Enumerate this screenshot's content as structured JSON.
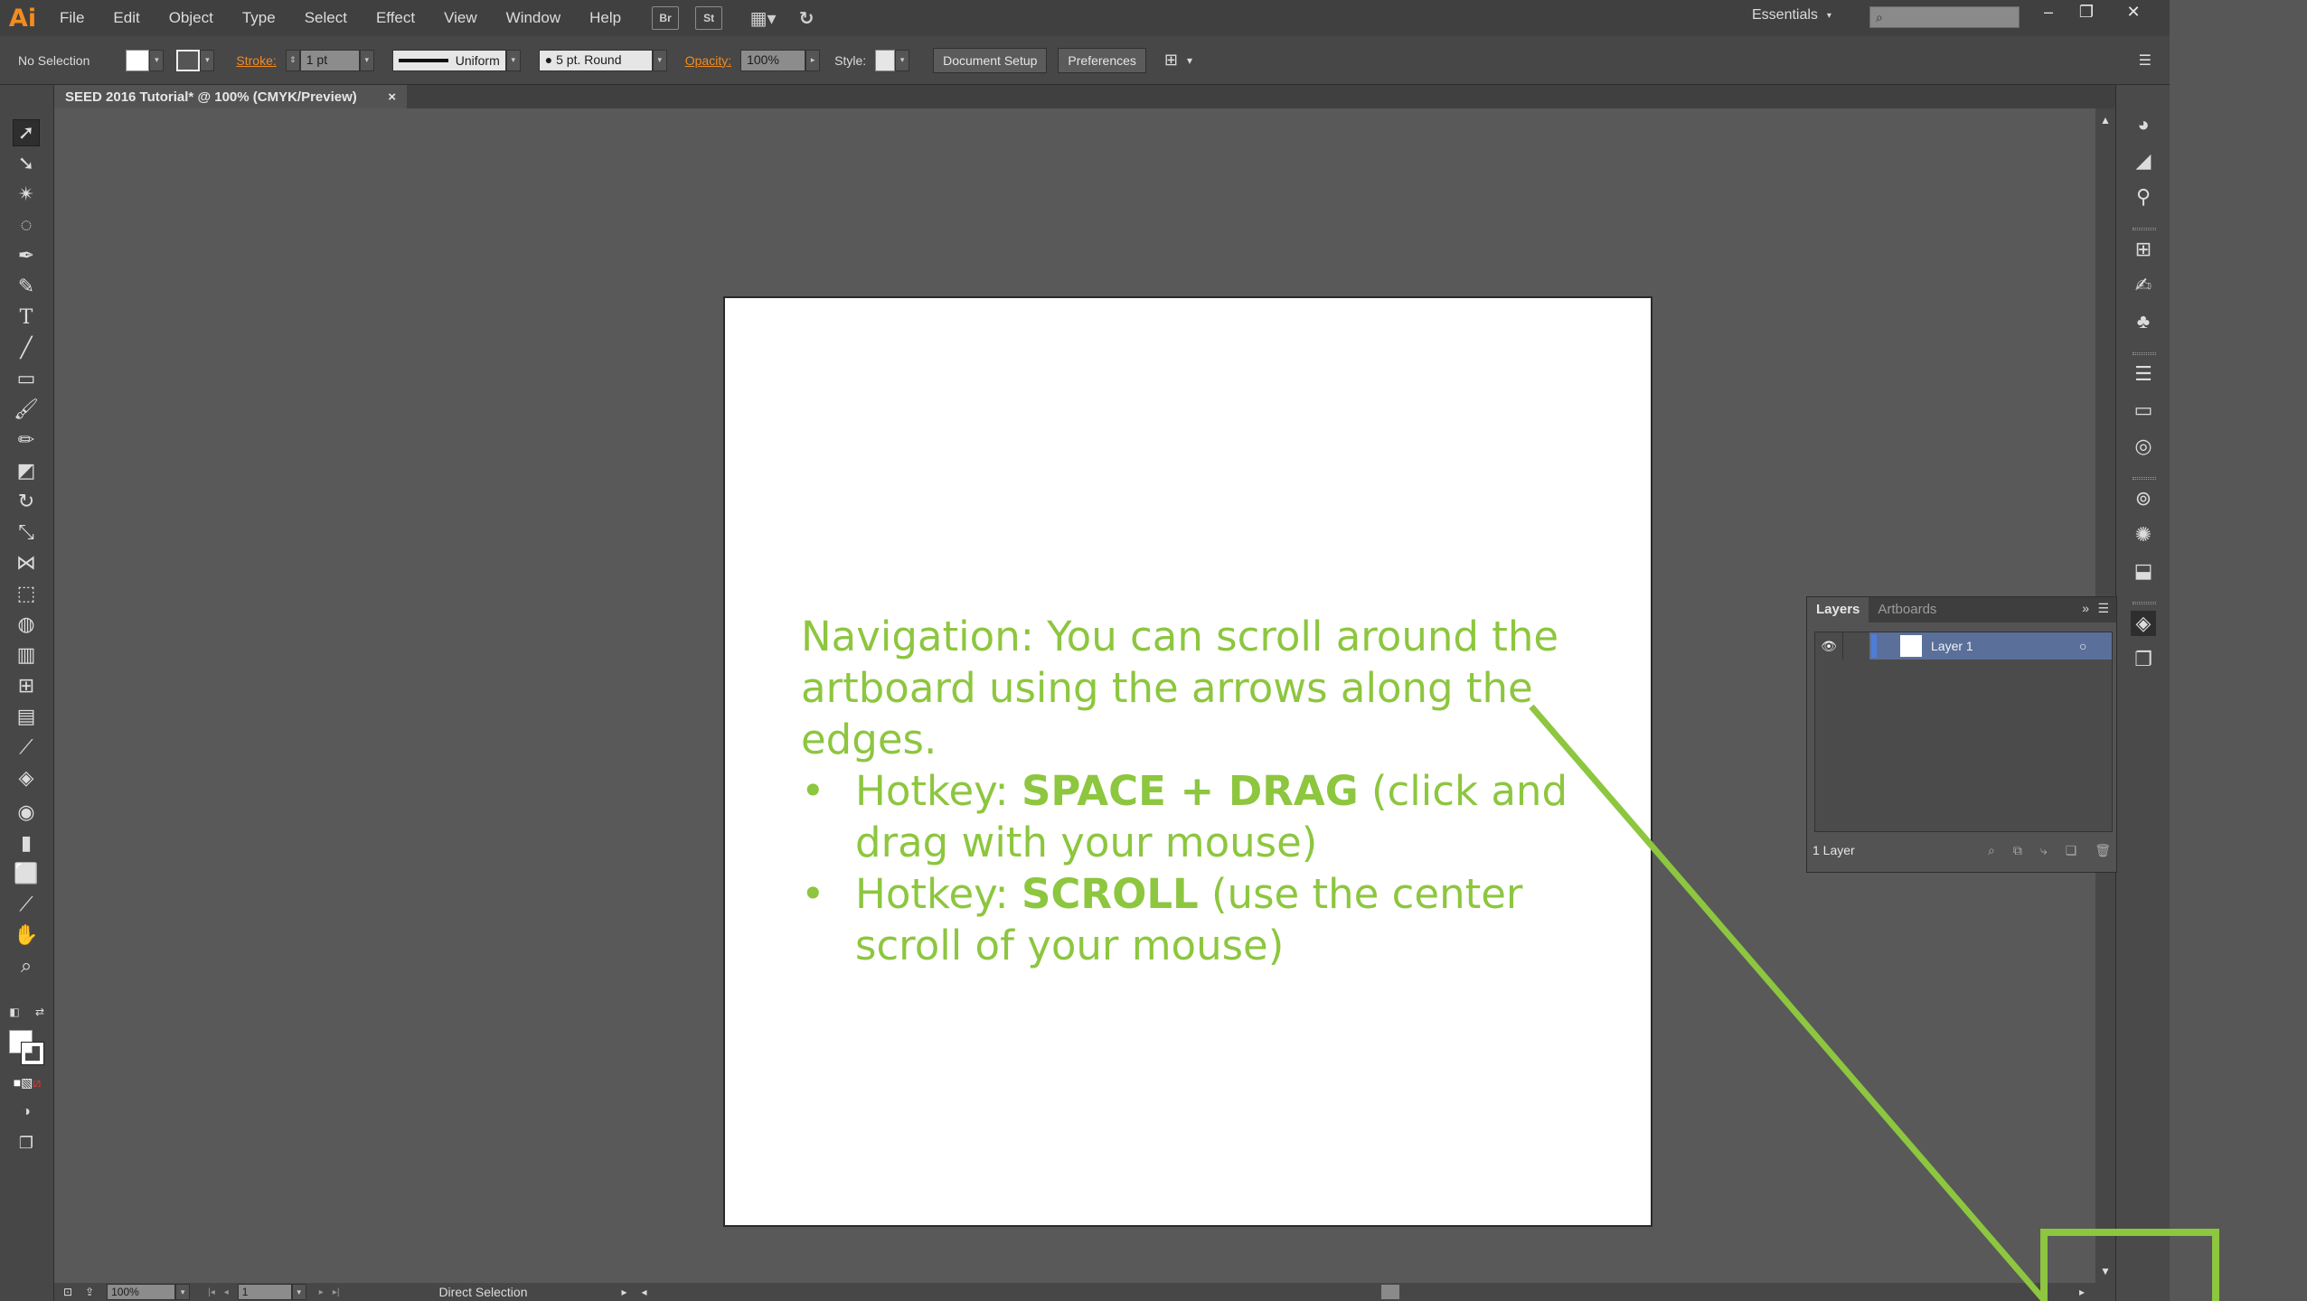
{
  "app": {
    "logo": "Ai",
    "document_tab": "SEED 2016 Tutorial* @ 100% (CMYK/Preview)"
  },
  "menu": {
    "items": [
      "File",
      "Edit",
      "Object",
      "Type",
      "Select",
      "Effect",
      "View",
      "Window",
      "Help"
    ],
    "bridge": "Br",
    "stock": "St",
    "workspace": "Essentials"
  },
  "controlbar": {
    "selection": "No Selection",
    "stroke_label": "Stroke:",
    "stroke_value": "1 pt",
    "profile": "Uniform",
    "brush": "5 pt. Round",
    "opacity_label": "Opacity:",
    "opacity_value": "100%",
    "style_label": "Style:",
    "doc_setup": "Document Setup",
    "preferences": "Preferences"
  },
  "artboard": {
    "intro": "Navigation: You can scroll around the artboard using the arrows along the edges.",
    "hotkey1_prefix": "Hotkey: ",
    "hotkey1_key": "SPACE + DRAG",
    "hotkey1_desc": " (click and drag with your mouse)",
    "hotkey2_prefix": "Hotkey: ",
    "hotkey2_key": "SCROLL",
    "hotkey2_desc": " (use the center scroll of your mouse)",
    "text_color": "#8dc63f"
  },
  "layers_panel": {
    "tab_layers": "Layers",
    "tab_artboards": "Artboards",
    "layer_name": "Layer 1",
    "footer_count": "1 Layer"
  },
  "statusbar": {
    "zoom": "100%",
    "artboard_num": "1",
    "tool": "Direct Selection"
  },
  "colors": {
    "accent": "#8dc63f",
    "orange": "#f38b1f"
  }
}
